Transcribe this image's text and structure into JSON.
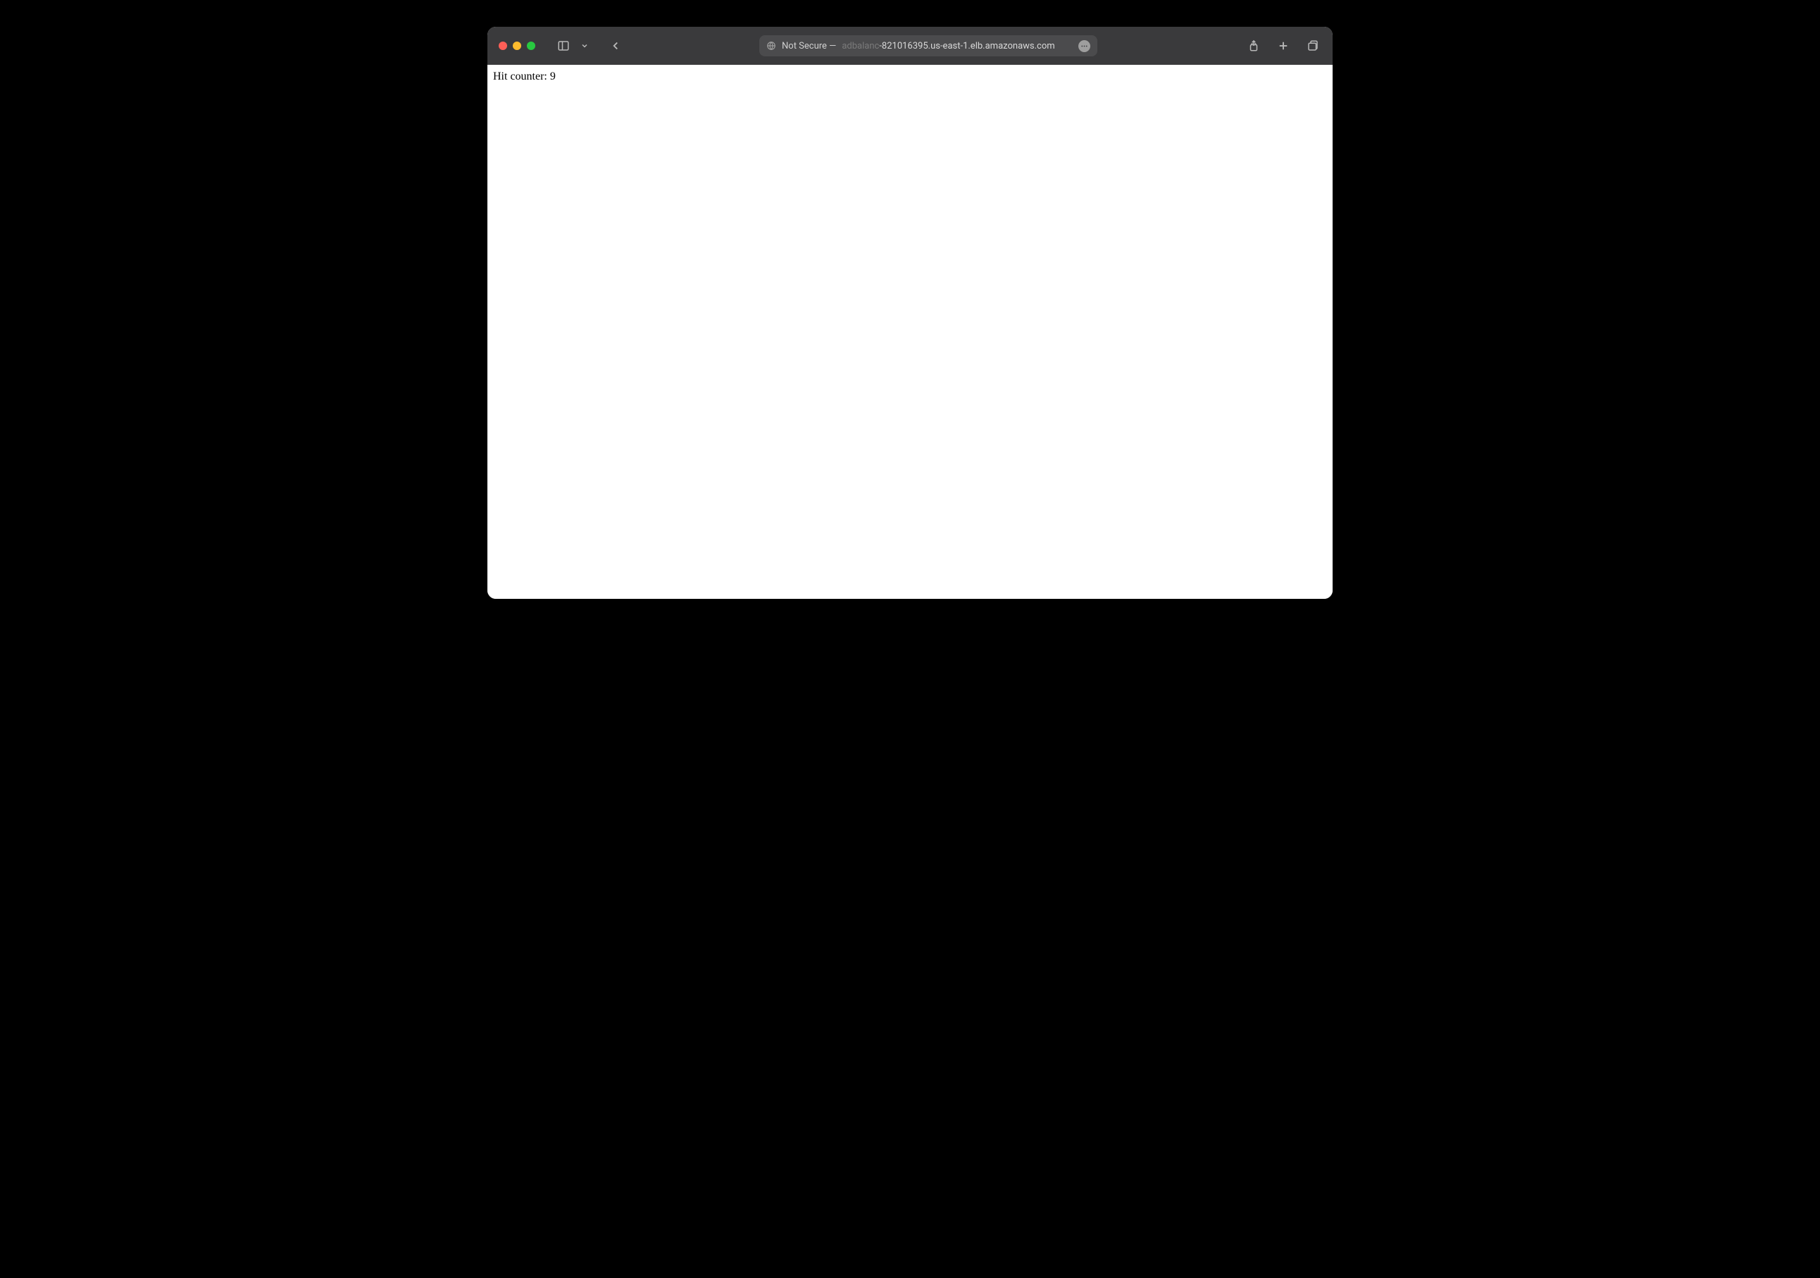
{
  "toolbar": {
    "security_label": "Not Secure —",
    "url_faded_prefix": "adbalanc",
    "url_visible": "-821016395.us-east-1.elb.amazonaws.com"
  },
  "page": {
    "hit_counter_label": "Hit counter: ",
    "hit_counter_value": "9"
  }
}
